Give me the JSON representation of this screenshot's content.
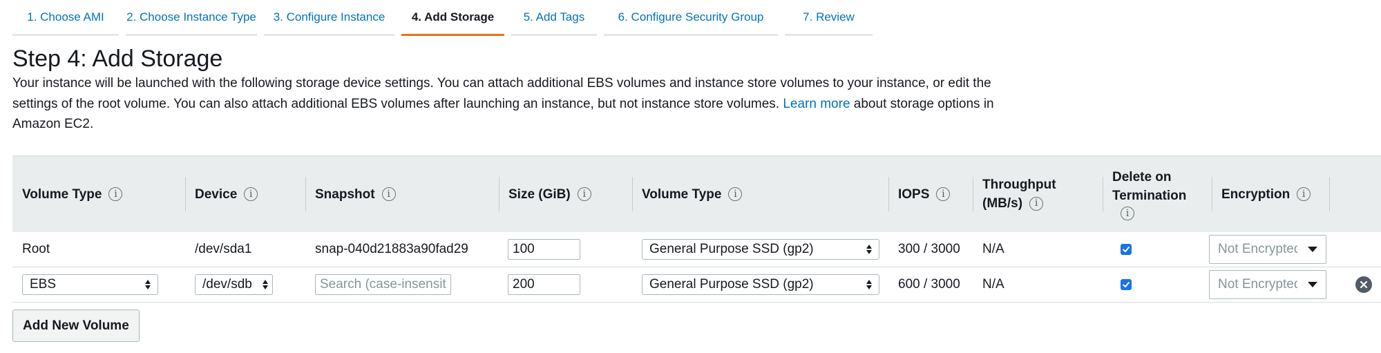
{
  "tabs": [
    {
      "label": "1. Choose AMI"
    },
    {
      "label": "2. Choose Instance Type"
    },
    {
      "label": "3. Configure Instance"
    },
    {
      "label": "4. Add Storage"
    },
    {
      "label": "5. Add Tags"
    },
    {
      "label": "6. Configure Security Group"
    },
    {
      "label": "7. Review"
    }
  ],
  "active_tab": "4. Add Storage",
  "page": {
    "title": "Step 4: Add Storage",
    "desc_part1": "Your instance will be launched with the following storage device settings. You can attach additional EBS volumes and instance store volumes to your instance, or edit the settings of the root volume. You can also attach additional EBS volumes after launching an instance, but not instance store volumes.",
    "learn_more": "Learn more",
    "desc_part2": "about storage options in Amazon EC2."
  },
  "table": {
    "headers": {
      "volume_type": "Volume Type",
      "device": "Device",
      "snapshot": "Snapshot",
      "size": "Size (GiB)",
      "ebs_volume_type": "Volume Type",
      "iops": "IOPS",
      "throughput_line1": "Throughput",
      "throughput_line2": "(MB/s)",
      "delete_line1": "Delete on",
      "delete_line2": "Termination",
      "encryption": "Encryption"
    },
    "info_glyph": "i",
    "rows": [
      {
        "volume_type": "Root",
        "device": "/dev/sda1",
        "snapshot": "snap-040d21883a90fad29",
        "size": "100",
        "ebs_volume_type": "General Purpose SSD (gp2)",
        "iops": "300 / 3000",
        "throughput": "N/A",
        "delete_on_termination": true,
        "encryption": "Not Encrypted"
      },
      {
        "volume_type": "EBS",
        "device": "/dev/sdb",
        "snapshot_placeholder": "Search (case-insensitive)",
        "size": "200",
        "ebs_volume_type": "General Purpose SSD (gp2)",
        "iops": "600 / 3000",
        "throughput": "N/A",
        "delete_on_termination": true,
        "encryption": "Not Encrypted"
      }
    ]
  },
  "buttons": {
    "add_new_volume": "Add New Volume"
  },
  "colors": {
    "link": "#0073bb",
    "active_tab_underline": "#ec7211",
    "table_header_bg": "#eaeded",
    "checkbox": "#1a73e8"
  },
  "icons": {
    "info": "info-icon",
    "remove": "remove-circle-icon",
    "select": "up-down-caret-icon",
    "dropdown": "caret-down-icon"
  }
}
